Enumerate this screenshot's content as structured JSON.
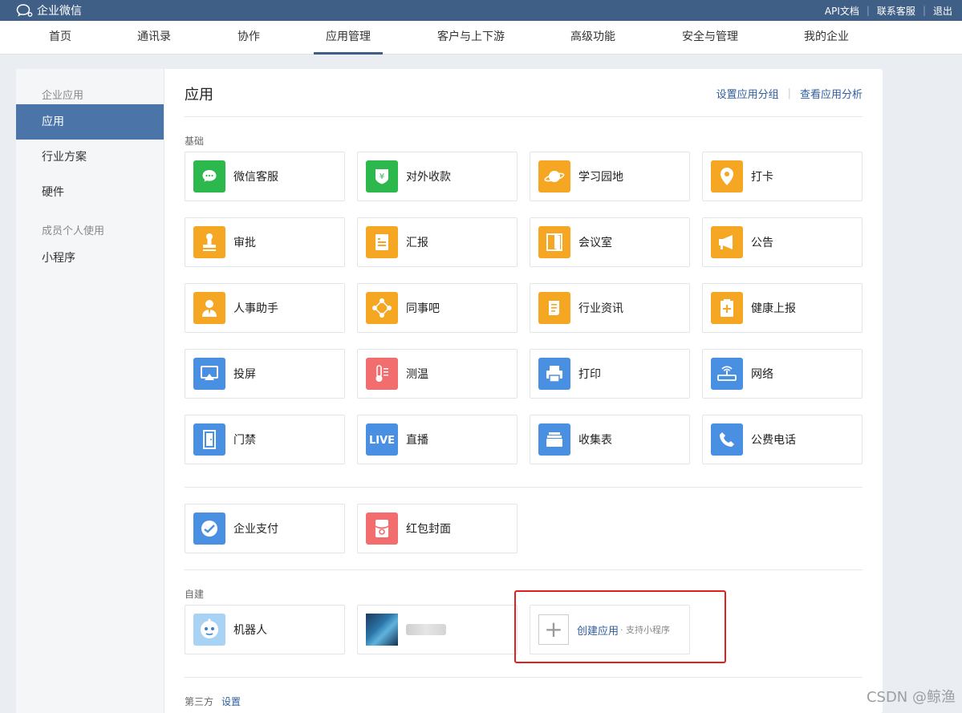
{
  "topbar": {
    "brand": "企业微信",
    "links": [
      "API文档",
      "联系客服",
      "退出"
    ]
  },
  "nav": {
    "items": [
      "首页",
      "通讯录",
      "协作",
      "应用管理",
      "客户与上下游",
      "高级功能",
      "安全与管理",
      "我的企业"
    ],
    "active": "应用管理"
  },
  "sidebar": {
    "group1": "企业应用",
    "items1": [
      "应用",
      "行业方案",
      "硬件"
    ],
    "group2": "成员个人使用",
    "items2": [
      "小程序"
    ]
  },
  "main": {
    "title": "应用",
    "actions": [
      "设置应用分组",
      "查看应用分析"
    ],
    "sections": {
      "basic": "基础",
      "custom": "自建",
      "third": "第三方",
      "third_link": "设置"
    },
    "basic_apps": [
      {
        "label": "微信客服",
        "icon": "wechat-service-icon",
        "color": "#2db84d"
      },
      {
        "label": "对外收款",
        "icon": "yuan-shield-icon",
        "color": "#2db84d"
      },
      {
        "label": "学习园地",
        "icon": "planet-icon",
        "color": "#f5a623"
      },
      {
        "label": "打卡",
        "icon": "location-pin-icon",
        "color": "#f5a623"
      },
      {
        "label": "审批",
        "icon": "stamp-icon",
        "color": "#f5a623"
      },
      {
        "label": "汇报",
        "icon": "report-icon",
        "color": "#f5a623"
      },
      {
        "label": "会议室",
        "icon": "door-icon",
        "color": "#f5a623"
      },
      {
        "label": "公告",
        "icon": "megaphone-icon",
        "color": "#f5a623"
      },
      {
        "label": "人事助手",
        "icon": "person-icon",
        "color": "#f5a623"
      },
      {
        "label": "同事吧",
        "icon": "network-icon",
        "color": "#f5a623"
      },
      {
        "label": "行业资讯",
        "icon": "scroll-icon",
        "color": "#f5a623"
      },
      {
        "label": "健康上报",
        "icon": "clipboard-plus-icon",
        "color": "#f5a623"
      },
      {
        "label": "投屏",
        "icon": "airplay-icon",
        "color": "#4a90e2"
      },
      {
        "label": "测温",
        "icon": "thermometer-icon",
        "color": "#f26d6d"
      },
      {
        "label": "打印",
        "icon": "printer-icon",
        "color": "#4a90e2"
      },
      {
        "label": "网络",
        "icon": "router-icon",
        "color": "#4a90e2"
      },
      {
        "label": "门禁",
        "icon": "access-door-icon",
        "color": "#4a90e2"
      },
      {
        "label": "直播",
        "icon": "live-icon",
        "color": "#4a90e2"
      },
      {
        "label": "收集表",
        "icon": "tray-icon",
        "color": "#4a90e2"
      },
      {
        "label": "公费电话",
        "icon": "phone-icon",
        "color": "#4a90e2"
      }
    ],
    "extra_apps": [
      {
        "label": "企业支付",
        "icon": "pay-icon",
        "color": "#4a90e2"
      },
      {
        "label": "红包封面",
        "icon": "red-packet-icon",
        "color": "#f26d6d"
      }
    ],
    "custom_apps": [
      {
        "label": "机器人",
        "icon": "robot-icon",
        "color": "#a9d3f5"
      }
    ],
    "create": {
      "label": "创建应用",
      "sub": "· 支持小程序"
    }
  },
  "watermark": "CSDN @鲸渔"
}
